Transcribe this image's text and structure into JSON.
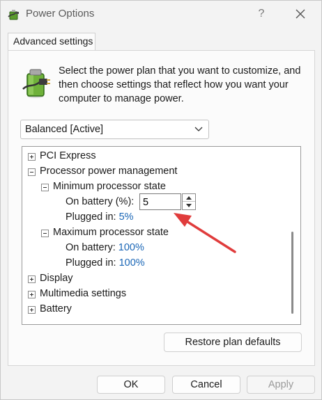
{
  "window": {
    "title": "Power Options",
    "help_label": "?"
  },
  "tabs": [
    {
      "label": "Advanced settings"
    }
  ],
  "intro_text": "Select the power plan that you want to customize, and then choose settings that reflect how you want your computer to manage power.",
  "plan_select": {
    "value": "Balanced [Active]"
  },
  "tree": {
    "pci": "PCI Express",
    "processor": "Processor power management",
    "min_state": "Minimum processor state",
    "min_on_battery_label": "On battery (%):",
    "min_on_battery_value": "5",
    "min_plugged_label": "Plugged in:",
    "min_plugged_value": "5%",
    "max_state": "Maximum processor state",
    "max_on_battery_label": "On battery:",
    "max_on_battery_value": "100%",
    "max_plugged_label": "Plugged in:",
    "max_plugged_value": "100%",
    "display": "Display",
    "multimedia": "Multimedia settings",
    "battery": "Battery"
  },
  "buttons": {
    "restore": "Restore plan defaults",
    "ok": "OK",
    "cancel": "Cancel",
    "apply": "Apply"
  },
  "colors": {
    "link": "#1a66b6",
    "annotation_arrow": "#e03c3c"
  }
}
